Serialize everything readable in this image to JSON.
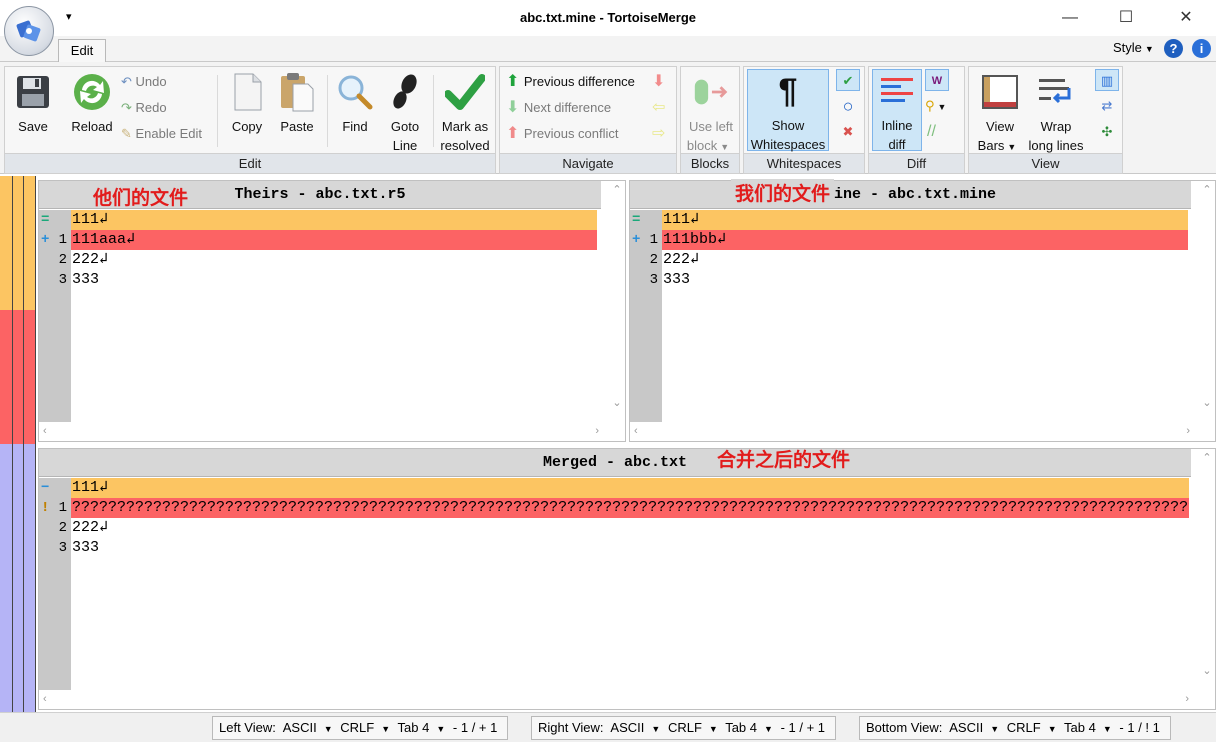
{
  "window": {
    "title": "abc.txt.mine - TortoiseMerge",
    "qat_glyph": "▾",
    "minimize": "—",
    "maximize": "☐",
    "close": "✕"
  },
  "ribbon": {
    "tab": "Edit",
    "style_menu": "Style",
    "help_glyph": "?",
    "info_glyph": "i",
    "groups": {
      "edit": {
        "label": "Edit",
        "save": "Save",
        "reload": "Reload",
        "undo": "Undo",
        "redo": "Redo",
        "enable_edit": "Enable Edit",
        "copy": "Copy",
        "paste": "Paste",
        "find": "Find",
        "goto_line_1": "Goto",
        "goto_line_2": "Line",
        "mark_resolved_1": "Mark as",
        "mark_resolved_2": "resolved"
      },
      "navigate": {
        "label": "Navigate",
        "previous_difference": "Previous difference",
        "next_difference": "Next difference",
        "previous_conflict": "Previous conflict"
      },
      "blocks": {
        "label": "Blocks",
        "use_left_1": "Use left",
        "use_left_2": "block"
      },
      "whitespaces": {
        "label": "Whitespaces",
        "show_1": "Show",
        "show_2": "Whitespaces"
      },
      "diff": {
        "label": "Diff",
        "inline_1": "Inline",
        "inline_2": "diff"
      },
      "view": {
        "label": "View",
        "view_bars_1": "View",
        "view_bars_2": "Bars",
        "wrap_1": "Wrap",
        "wrap_2": "long lines"
      }
    }
  },
  "panes": {
    "theirs": {
      "header": "Theirs - abc.txt.r5",
      "annotation": "他们的文件",
      "lines": [
        {
          "num": "",
          "marker": "equal",
          "text": "111↲",
          "state": "eq"
        },
        {
          "num": "1",
          "marker": "added",
          "text": "111aaa↲",
          "state": "chg"
        },
        {
          "num": "2",
          "marker": "",
          "text": "222↲",
          "state": ""
        },
        {
          "num": "3",
          "marker": "",
          "text": "333",
          "state": ""
        }
      ]
    },
    "mine": {
      "header": "Mine - abc.txt.mine",
      "annotation": "我们的文件",
      "lines": [
        {
          "num": "",
          "marker": "equal",
          "text": "111↲",
          "state": "eq"
        },
        {
          "num": "1",
          "marker": "added",
          "text": "111bbb↲",
          "state": "chg"
        },
        {
          "num": "2",
          "marker": "",
          "text": "222↲",
          "state": ""
        },
        {
          "num": "3",
          "marker": "",
          "text": "333",
          "state": ""
        }
      ]
    },
    "merged": {
      "header": "Merged - abc.txt",
      "annotation": "合并之后的文件",
      "lines": [
        {
          "num": "",
          "marker": "removed",
          "text": "111↲",
          "state": "eq"
        },
        {
          "num": "1",
          "marker": "conflict",
          "text": "?????????????????????????????????????????????????????????????????????????????????????????????????????????????????????????????",
          "state": "chg"
        },
        {
          "num": "2",
          "marker": "",
          "text": "222↲",
          "state": ""
        },
        {
          "num": "3",
          "marker": "",
          "text": "333",
          "state": ""
        }
      ]
    }
  },
  "statusbar": {
    "left": {
      "label": "Left View:",
      "encoding": "ASCII",
      "eol": "CRLF",
      "tab": "Tab 4",
      "counts": "- 1 / + 1"
    },
    "right": {
      "label": "Right View:",
      "encoding": "ASCII",
      "eol": "CRLF",
      "tab": "Tab 4",
      "counts": "- 1 / + 1"
    },
    "bottom": {
      "label": "Bottom View:",
      "encoding": "ASCII",
      "eol": "CRLF",
      "tab": "Tab 4",
      "counts": "- 1 / ! 1"
    }
  },
  "colors": {
    "equal_line": "#fcc562",
    "changed_line": "#fc6364",
    "merged_bar": "#b5b4f6"
  }
}
